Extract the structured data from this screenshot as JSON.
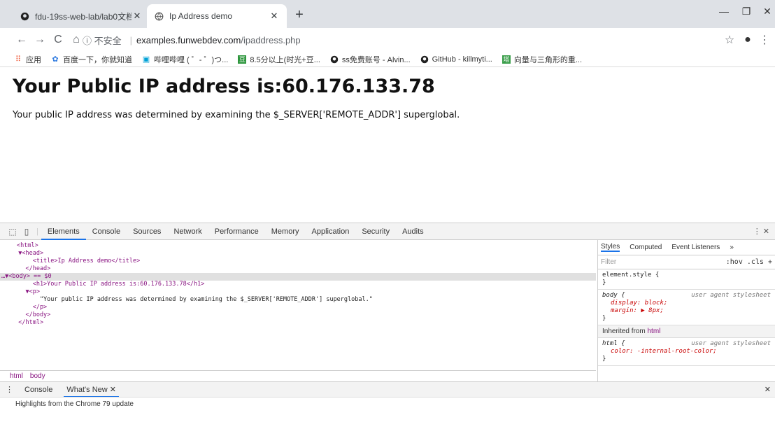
{
  "browser": {
    "tabs": [
      {
        "title": "fdu-19ss-web-lab/lab0文档.md",
        "close": "✕"
      },
      {
        "title": "Ip Address demo",
        "close": "✕"
      }
    ],
    "new_tab": "+",
    "window_controls": {
      "minimize": "—",
      "maximize": "❐",
      "close": "✕"
    },
    "nav": {
      "back": "←",
      "forward": "→",
      "reload": "C",
      "home": "⌂"
    },
    "omnibox": {
      "info": "ⓘ 不安全",
      "url_domain": "examples.funwebdev.com",
      "url_path": "/ipaddress.php"
    },
    "bookmarks": [
      {
        "label": "应用",
        "icon": "apps-icon"
      },
      {
        "label": "百度一下，你就知道",
        "icon": "baidu-icon"
      },
      {
        "label": "哔哩哔哩 ( ゜- ゜)つ...",
        "icon": "bilibili-icon"
      },
      {
        "label": "8.5分以上(时光+豆...",
        "icon": "douban-icon"
      },
      {
        "label": "ss免费账号 - Alvin...",
        "icon": "github-icon"
      },
      {
        "label": "GitHub - killmyti...",
        "icon": "github-icon"
      },
      {
        "label": "向量与三角形的重...",
        "icon": "page-icon"
      }
    ]
  },
  "page": {
    "heading": "Your Public IP address is:60.176.133.78",
    "paragraph": "Your public IP address was determined by examining the $_SERVER['REMOTE_ADDR'] superglobal."
  },
  "devtools": {
    "tabs": [
      "Elements",
      "Console",
      "Sources",
      "Network",
      "Performance",
      "Memory",
      "Application",
      "Security",
      "Audits"
    ],
    "dom_lines": [
      "<html>",
      "  ▼<head>",
      "      <title>Ip Address demo</title>",
      "    </head>",
      "…▼<body> == $0",
      "      <h1>Your Public IP address is:60.176.133.78</h1>",
      "    ▼<p>",
      "        \"Your public IP address was determined by examining the $_SERVER['REMOTE_ADDR'] superglobal.\"",
      "      </p>",
      "    </body>",
      "  </html>"
    ],
    "breadcrumbs": [
      "html",
      "body"
    ],
    "styles_tabs": [
      "Styles",
      "Computed",
      "Event Listeners",
      "»"
    ],
    "filter_placeholder": "Filter",
    "filter_buttons": ":hov  .cls  +",
    "rules": {
      "element_style": "element.style {",
      "element_close": "}",
      "body_sel": "body {",
      "body_src": "user agent stylesheet",
      "body_prop1": "display: block;",
      "body_prop2": "margin: ▶ 8px;",
      "body_close": "}",
      "inherited_label": "Inherited from",
      "inherited_tag": "html",
      "html_sel": "html {",
      "html_src": "user agent stylesheet",
      "html_prop1": "color: -internal-root-color;",
      "html_close": "}"
    },
    "drawer": {
      "menu": "⋮",
      "tabs": [
        "Console",
        "What's New ✕"
      ],
      "highlights": "Highlights from the Chrome 79 update"
    }
  }
}
